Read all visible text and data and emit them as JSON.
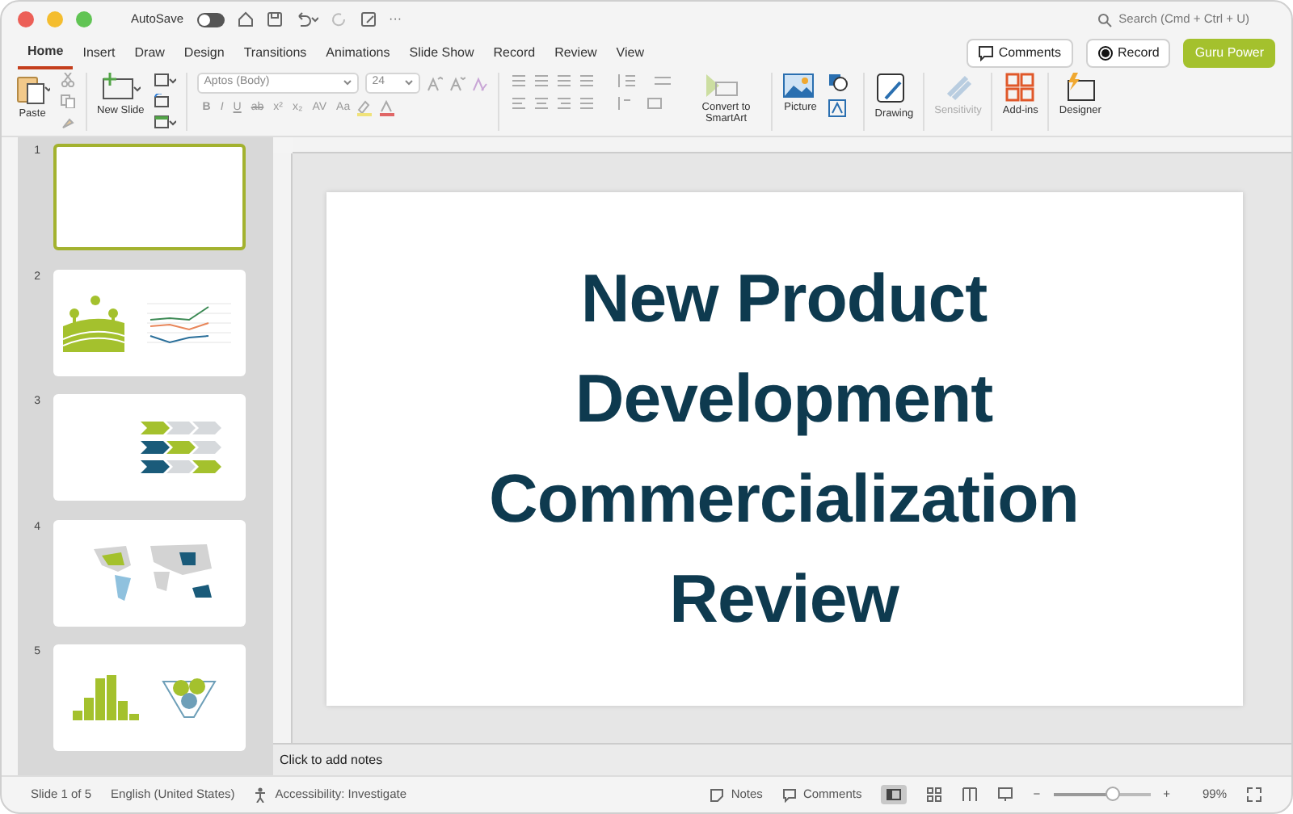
{
  "title_bar": {
    "autosave_label": "AutoSave",
    "autosave_on": false,
    "more": "···",
    "search_placeholder": "Search (Cmd + Ctrl + U)"
  },
  "tabs": [
    {
      "label": "Home",
      "selected": true
    },
    {
      "label": "Insert",
      "selected": false
    },
    {
      "label": "Draw",
      "selected": false
    },
    {
      "label": "Design",
      "selected": false
    },
    {
      "label": "Transitions",
      "selected": false
    },
    {
      "label": "Animations",
      "selected": false
    },
    {
      "label": "Slide Show",
      "selected": false
    },
    {
      "label": "Record",
      "selected": false
    },
    {
      "label": "Review",
      "selected": false
    },
    {
      "label": "View",
      "selected": false
    }
  ],
  "header_buttons": [
    {
      "kind": "comments",
      "label": "Comments"
    },
    {
      "kind": "record",
      "label": "Record"
    },
    {
      "kind": "accent",
      "label": "Guru Power"
    }
  ],
  "ribbon": {
    "paste": "Paste",
    "new_slide": "New Slide",
    "font_name": "Aptos (Body)",
    "font_size": "24",
    "format_glyphs": [
      "B",
      "I",
      "U",
      "ab",
      "x²",
      "x₂",
      "AV",
      "Aa"
    ],
    "convert": "Convert to SmartArt",
    "picture": "Picture",
    "drawing": "Drawing",
    "sensitivity": {
      "label": "Sensitivity",
      "disabled": true
    },
    "addins": "Add-ins",
    "designer": "Designer"
  },
  "slides": [
    {
      "number": "1",
      "kind": "blank",
      "selected": true
    },
    {
      "number": "2",
      "kind": "farm_chart",
      "selected": false
    },
    {
      "number": "3",
      "kind": "arrows",
      "selected": false
    },
    {
      "number": "4",
      "kind": "map",
      "selected": false
    },
    {
      "number": "5",
      "kind": "histogram",
      "selected": false
    }
  ],
  "slide": {
    "title_lines": [
      "New Product",
      "Development",
      "Commercialization",
      "Review"
    ]
  },
  "notes_placeholder": "Click to add notes",
  "status_bar": {
    "slide_position": "Slide 1 of 5",
    "language": "English (United States)",
    "accessibility": "Accessibility: Investigate",
    "notes": "Notes",
    "comments": "Comments",
    "zoom_minus": "−",
    "zoom_plus": "+",
    "zoom": {
      "level": 0.6
    },
    "zoom_text": "99%"
  }
}
